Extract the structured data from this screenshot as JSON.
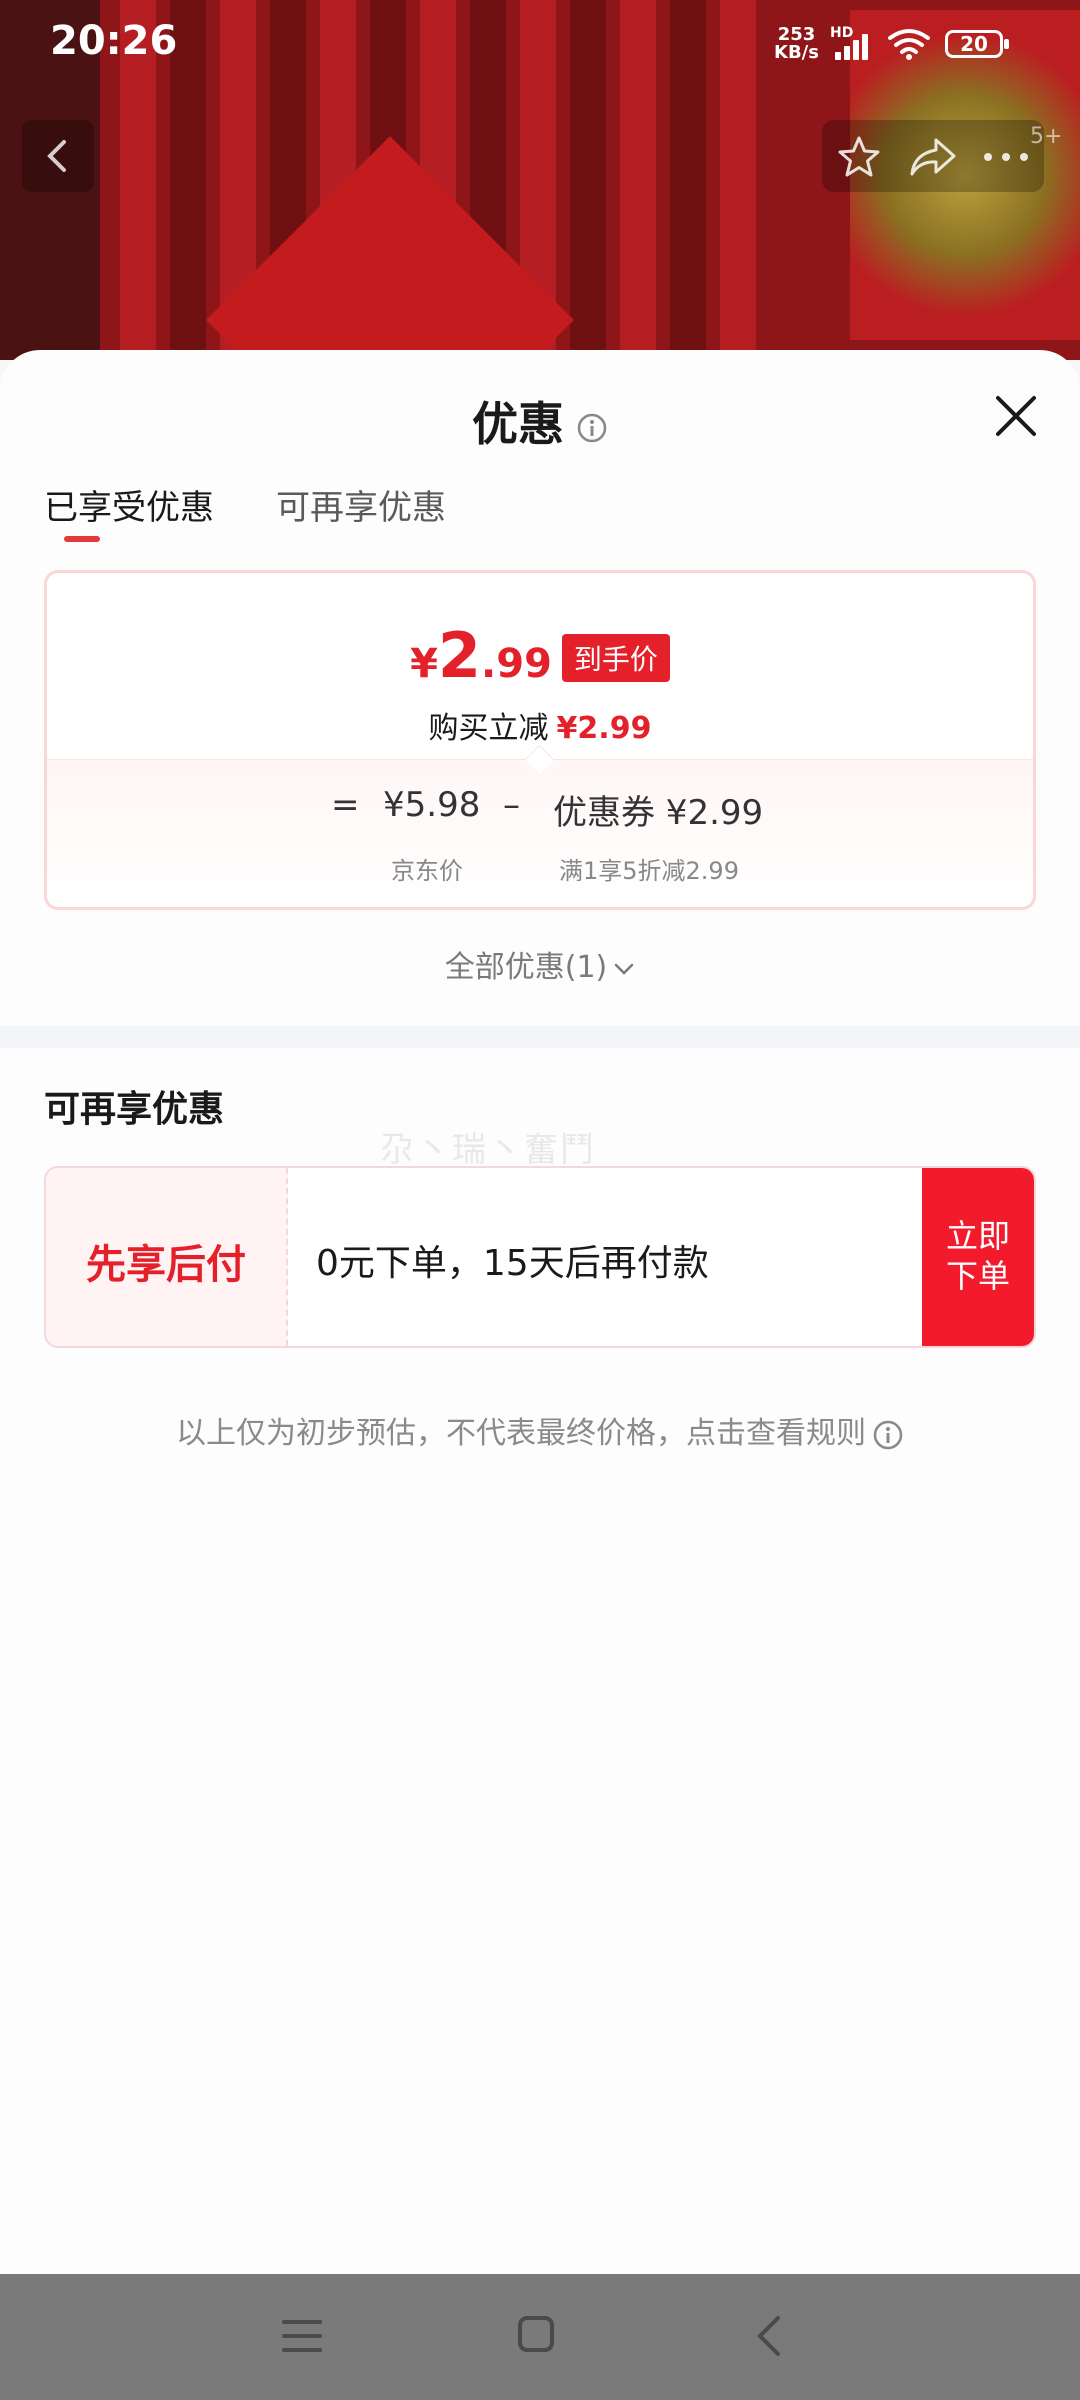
{
  "status_bar": {
    "time": "20:26",
    "speed_top": "253",
    "speed_bottom": "KB/s",
    "hd": "HD",
    "battery": "20"
  },
  "nav": {
    "badge": "5+",
    "icons": [
      "back-icon",
      "star-icon",
      "share-icon",
      "more-icon"
    ]
  },
  "sheet": {
    "title": "优惠",
    "tabs": [
      {
        "label": "已享受优惠",
        "active": true
      },
      {
        "label": "可再享优惠",
        "active": false
      }
    ],
    "price": {
      "yen": "¥",
      "int": "2",
      "dec": ".99",
      "tag": "到手价",
      "reduce_label": "购买立减",
      "reduce_amount": "¥2.99"
    },
    "formula": {
      "equals": "=",
      "jd_price": "¥5.98",
      "minus": "–",
      "coupon": "优惠券 ¥2.99",
      "jd_label": "京东价",
      "coupon_label": "满1享5折减2.99"
    },
    "all_offers": "全部优惠(1)",
    "section_title": "可再享优惠",
    "watermark": "尕丶瑞丶奮鬥",
    "pay_later": {
      "label": "先享后付",
      "desc": "0元下单，15天后再付款",
      "button_line1": "立即",
      "button_line2": "下单"
    },
    "note": "以上仅为初步预估，不代表最终价格，点击查看规则"
  },
  "colors": {
    "accent": "#e4202a",
    "button": "#f31a2c",
    "navbar": "#7a7a7a"
  }
}
